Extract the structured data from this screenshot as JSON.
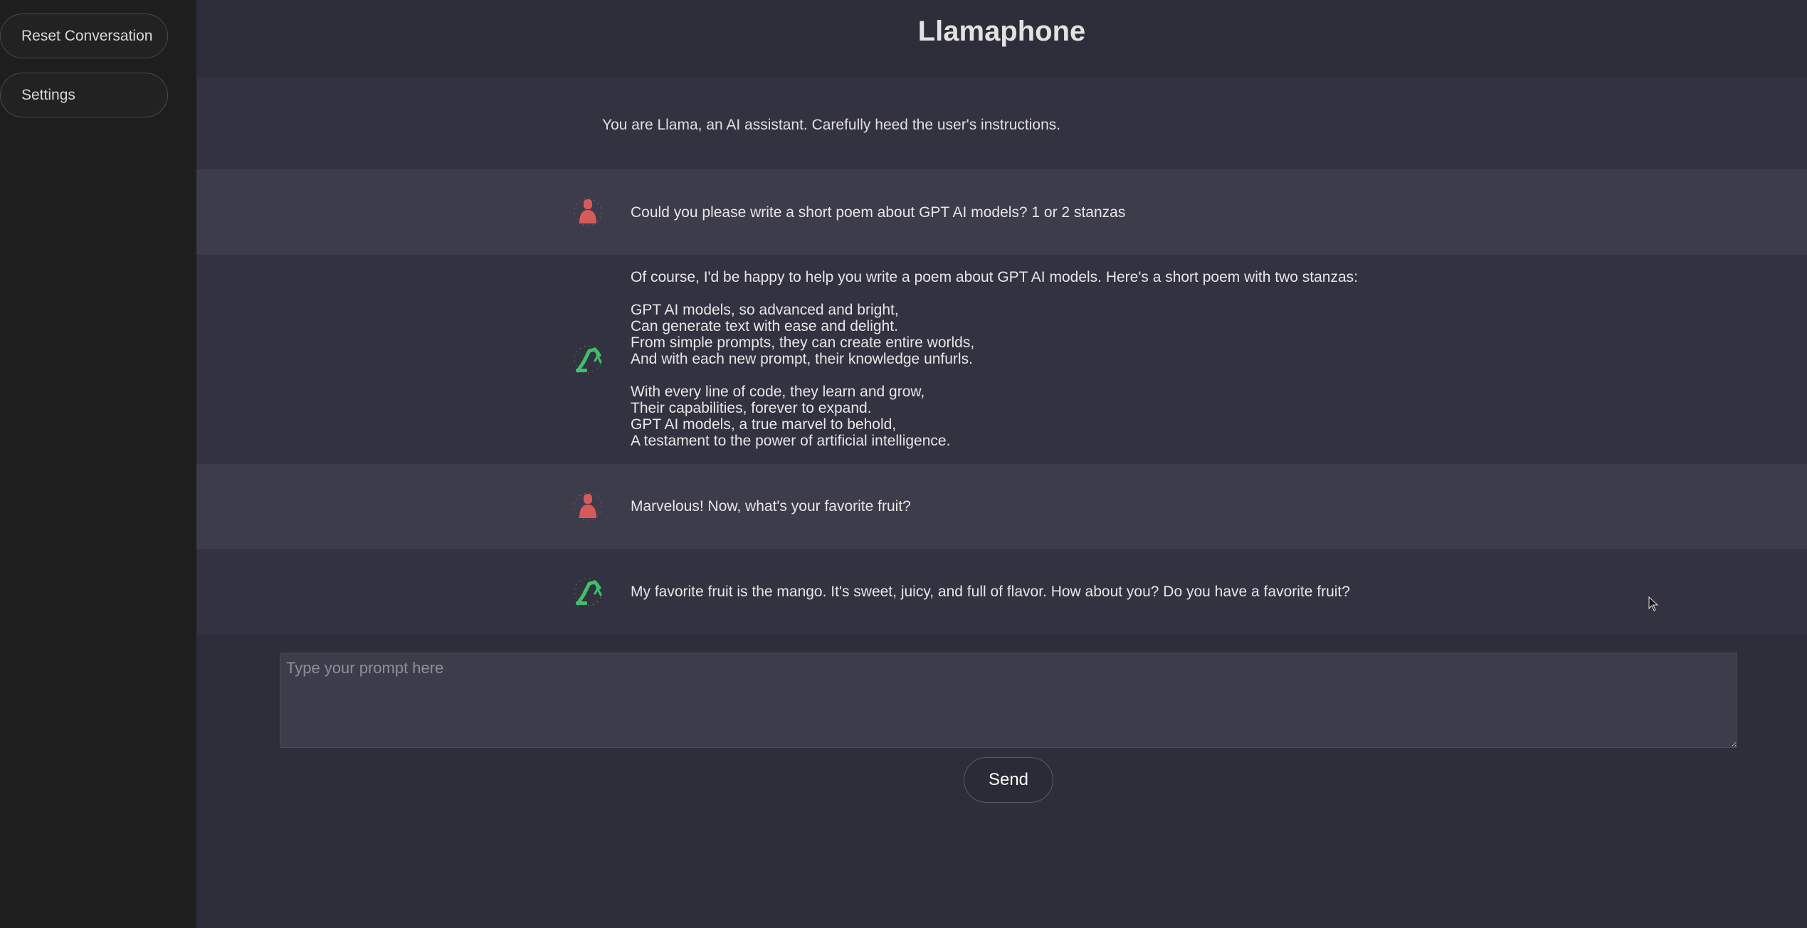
{
  "sidebar": {
    "reset_label": "Reset Conversation",
    "settings_label": "Settings"
  },
  "header": {
    "title": "Llamaphone"
  },
  "system_message": "You are Llama, an AI assistant. Carefully heed the user's instructions.",
  "messages": [
    {
      "role": "user",
      "avatar": "user-icon",
      "text": "Could you please write a short poem about GPT AI models? 1 or 2 stanzas"
    },
    {
      "role": "assistant",
      "avatar": "robot-arm-icon",
      "text": "Of course, I'd be happy to help you write a poem about GPT AI models. Here's a short poem with two stanzas:\n\nGPT AI models, so advanced and bright,\nCan generate text with ease and delight.\nFrom simple prompts, they can create entire worlds,\nAnd with each new prompt, their knowledge unfurls.\n\nWith every line of code, they learn and grow,\nTheir capabilities, forever to expand.\nGPT AI models, a true marvel to behold,\nA testament to the power of artificial intelligence."
    },
    {
      "role": "user",
      "avatar": "user-icon",
      "text": "Marvelous! Now, what's your favorite fruit?"
    },
    {
      "role": "assistant",
      "avatar": "robot-arm-icon",
      "text": "My favorite fruit is the mango. It's sweet, juicy, and full of flavor. How about you? Do you have a favorite fruit?"
    }
  ],
  "input": {
    "placeholder": "Type your prompt here",
    "value": ""
  },
  "send_label": "Send",
  "colors": {
    "user_avatar": "#d65a5a",
    "bot_avatar": "#3fbf6a"
  }
}
